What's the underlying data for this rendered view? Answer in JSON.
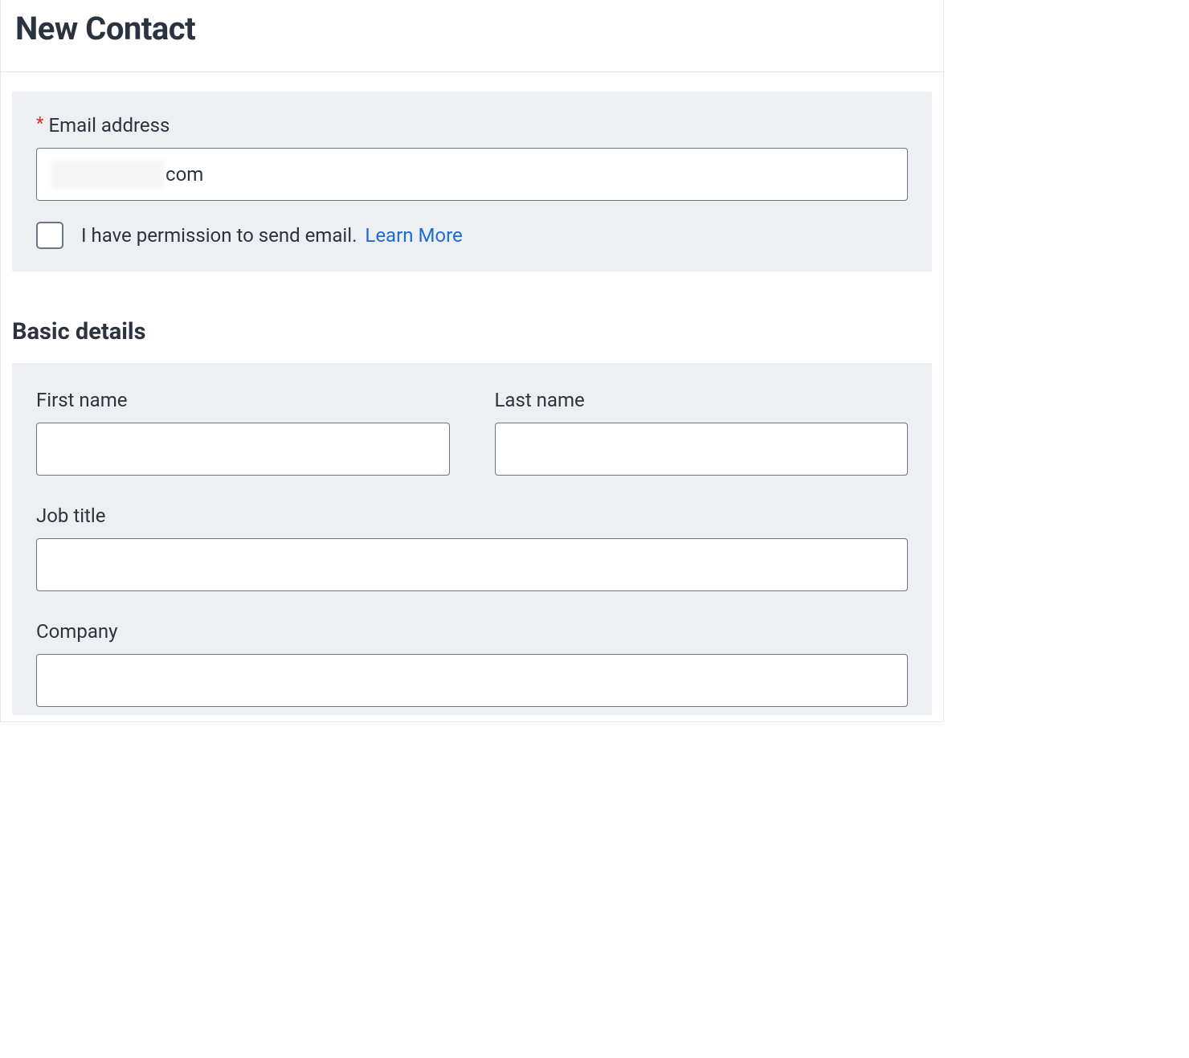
{
  "header": {
    "title": "New Contact"
  },
  "email_section": {
    "label": "Email address",
    "value_suffix": "com",
    "permission_text": "I have permission to send email.",
    "learn_more": "Learn More"
  },
  "basic_details": {
    "title": "Basic details",
    "first_name_label": "First name",
    "last_name_label": "Last name",
    "job_title_label": "Job title",
    "company_label": "Company",
    "first_name_value": "",
    "last_name_value": "",
    "job_title_value": "",
    "company_value": ""
  }
}
